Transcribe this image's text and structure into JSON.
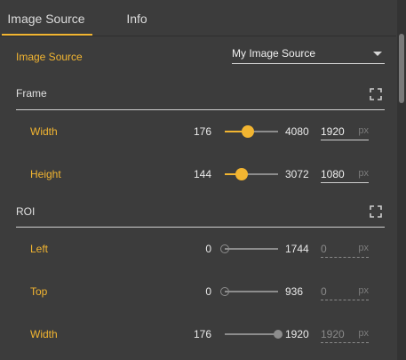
{
  "tabs": [
    {
      "label": "Image Source",
      "active": true
    },
    {
      "label": "Info",
      "active": false
    }
  ],
  "source": {
    "label": "Image Source",
    "selected": "My Image Source"
  },
  "frame": {
    "title": "Frame",
    "width": {
      "label": "Width",
      "min": "176",
      "max": "4080",
      "value": "1920",
      "unit": "px",
      "fraction": 0.43
    },
    "height": {
      "label": "Height",
      "min": "144",
      "max": "3072",
      "value": "1080",
      "unit": "px",
      "fraction": 0.32
    }
  },
  "roi": {
    "title": "ROI",
    "left": {
      "label": "Left",
      "min": "0",
      "max": "1744",
      "value": "0",
      "unit": "px",
      "fraction": 0.0
    },
    "top": {
      "label": "Top",
      "min": "0",
      "max": "936",
      "value": "0",
      "unit": "px",
      "fraction": 0.0
    },
    "width": {
      "label": "Width",
      "min": "176",
      "max": "1920",
      "value": "1920",
      "unit": "px",
      "fraction": 1.0
    }
  },
  "colors": {
    "accent": "#f2b531",
    "background": "#3c3c3c",
    "track": "#8c8c8c"
  },
  "icons": {
    "frame_expand": "fullscreen-icon",
    "roi_expand": "fullscreen-icon"
  }
}
